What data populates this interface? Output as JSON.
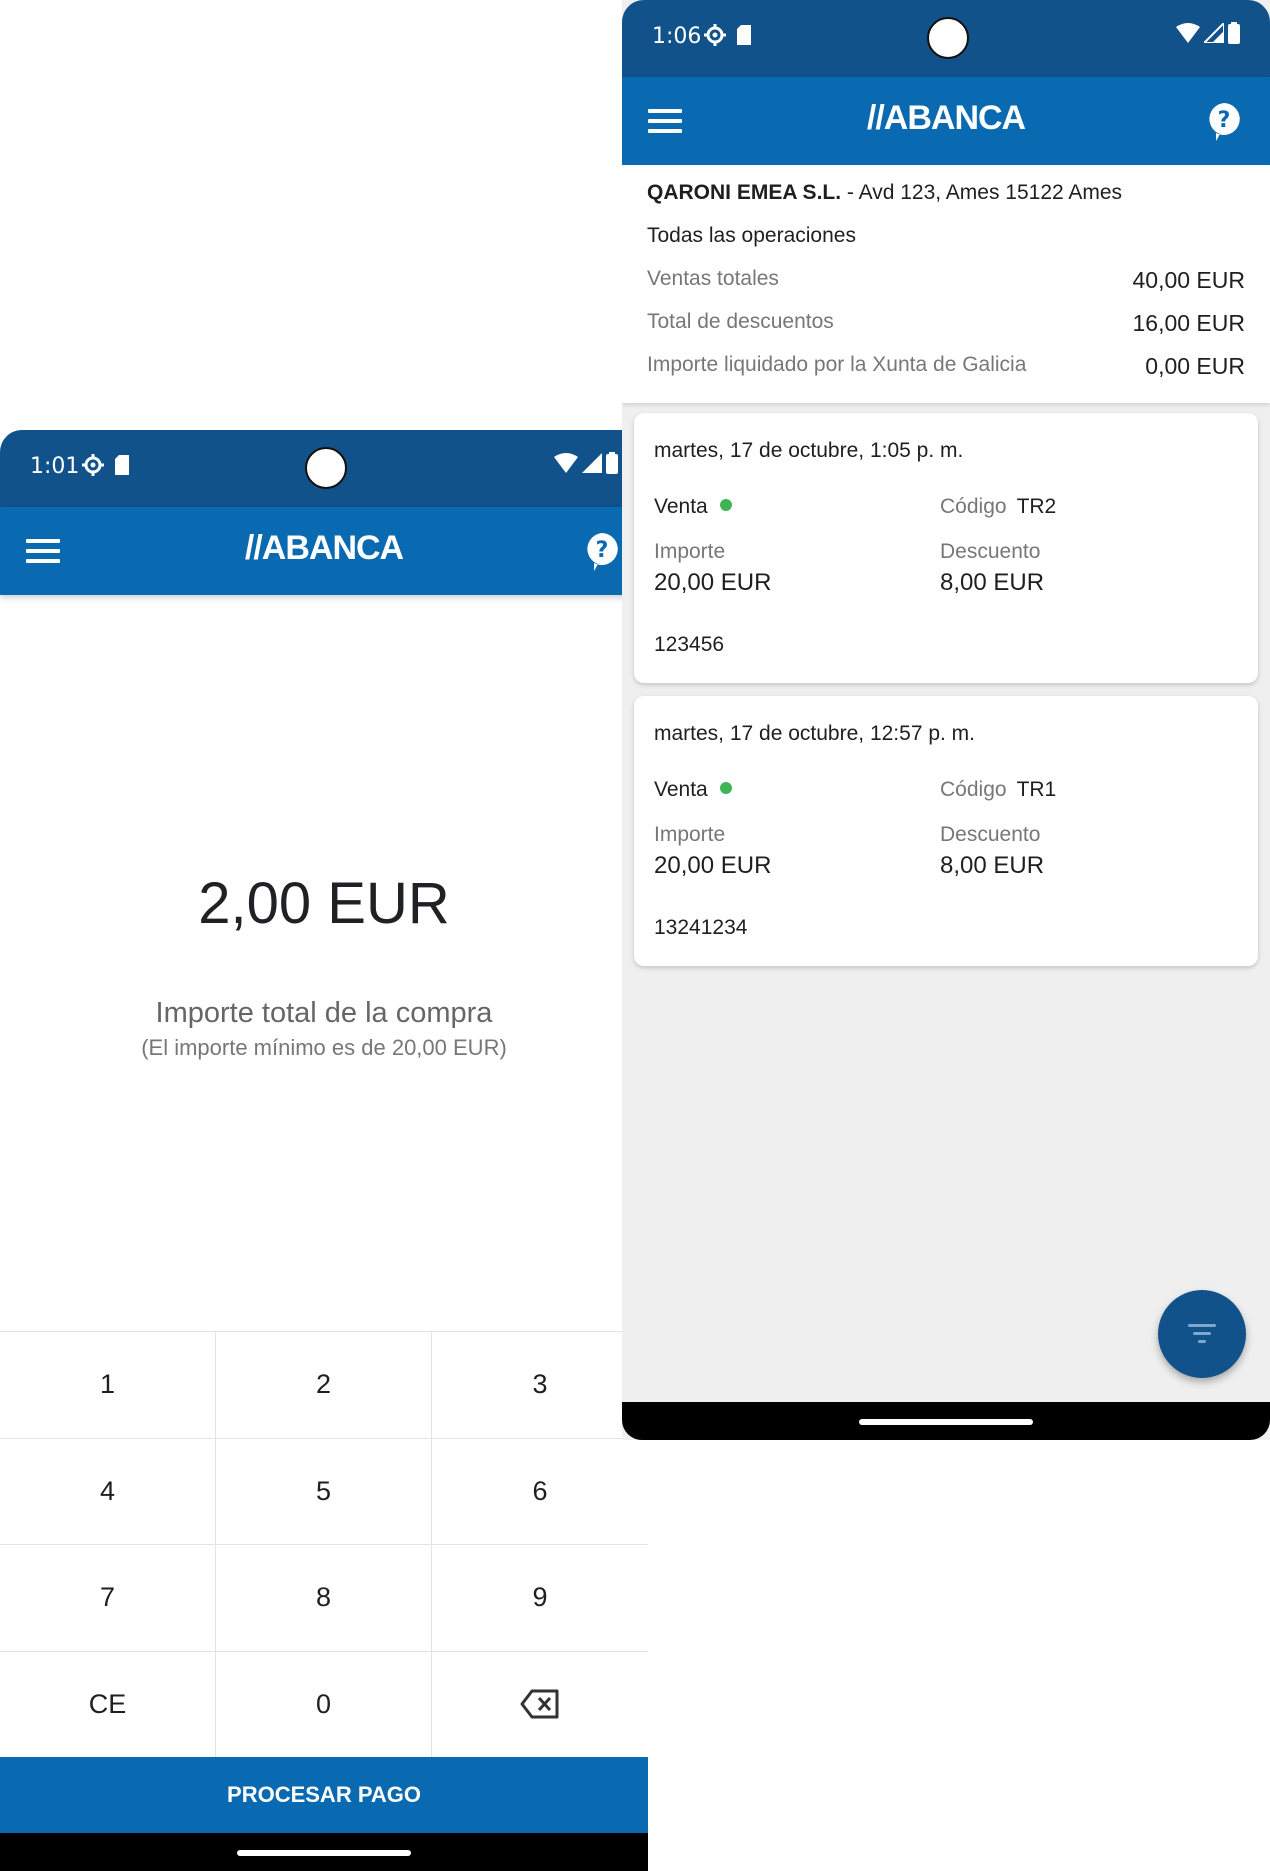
{
  "left_screen": {
    "status": {
      "time": "1:01"
    },
    "app_bar": {
      "logo": "//ABANCA"
    },
    "amount": {
      "value": "2,00 EUR",
      "label": "Importe total de la compra",
      "hint": "(El importe mínimo es de 20,00 EUR)"
    },
    "keypad": {
      "keys": [
        "1",
        "2",
        "3",
        "4",
        "5",
        "6",
        "7",
        "8",
        "9",
        "CE",
        "0"
      ]
    },
    "process_button": "PROCESAR PAGO"
  },
  "right_screen": {
    "status": {
      "time": "1:06"
    },
    "app_bar": {
      "logo": "//ABANCA"
    },
    "summary": {
      "merchant_name": "QARONI EMEA S.L.",
      "merchant_address": " - Avd 123, Ames 15122 Ames",
      "heading": "Todas las operaciones",
      "rows": [
        {
          "label": "Ventas totales",
          "value": "40,00 EUR"
        },
        {
          "label": "Total de descuentos",
          "value": "16,00 EUR"
        },
        {
          "label": "Importe liquidado por la Xunta de Galicia",
          "value": "0,00 EUR"
        }
      ]
    },
    "transactions": [
      {
        "date": "martes, 17 de octubre, 1:05 p. m.",
        "type": "Venta",
        "code_label": "Código",
        "code": "TR2",
        "amount_label": "Importe",
        "amount": "20,00 EUR",
        "discount_label": "Descuento",
        "discount": "8,00 EUR",
        "reference": "123456"
      },
      {
        "date": "martes, 17 de octubre, 12:57 p. m.",
        "type": "Venta",
        "code_label": "Código",
        "code": "TR1",
        "amount_label": "Importe",
        "amount": "20,00 EUR",
        "discount_label": "Descuento",
        "discount": "8,00 EUR",
        "reference": "13241234"
      }
    ]
  },
  "colors": {
    "status_bar": "#11528a",
    "app_bar": "#0a6ab1",
    "status_dot": "#3fb454",
    "fab": "#11528a"
  },
  "icons": [
    "menu-icon",
    "help-icon",
    "settings-icon",
    "sd-card-icon",
    "wifi-icon",
    "signal-icon",
    "battery-icon",
    "backspace-icon",
    "filter-icon"
  ]
}
